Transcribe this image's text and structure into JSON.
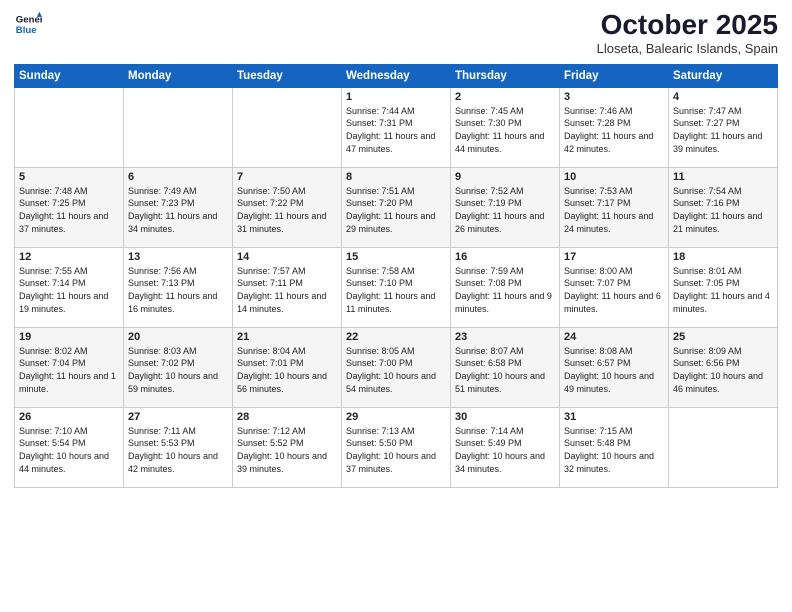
{
  "logo": {
    "line1": "General",
    "line2": "Blue"
  },
  "title": "October 2025",
  "subtitle": "Lloseta, Balearic Islands, Spain",
  "days_of_week": [
    "Sunday",
    "Monday",
    "Tuesday",
    "Wednesday",
    "Thursday",
    "Friday",
    "Saturday"
  ],
  "weeks": [
    [
      {
        "num": "",
        "info": ""
      },
      {
        "num": "",
        "info": ""
      },
      {
        "num": "",
        "info": ""
      },
      {
        "num": "1",
        "info": "Sunrise: 7:44 AM\nSunset: 7:31 PM\nDaylight: 11 hours and 47 minutes."
      },
      {
        "num": "2",
        "info": "Sunrise: 7:45 AM\nSunset: 7:30 PM\nDaylight: 11 hours and 44 minutes."
      },
      {
        "num": "3",
        "info": "Sunrise: 7:46 AM\nSunset: 7:28 PM\nDaylight: 11 hours and 42 minutes."
      },
      {
        "num": "4",
        "info": "Sunrise: 7:47 AM\nSunset: 7:27 PM\nDaylight: 11 hours and 39 minutes."
      }
    ],
    [
      {
        "num": "5",
        "info": "Sunrise: 7:48 AM\nSunset: 7:25 PM\nDaylight: 11 hours and 37 minutes."
      },
      {
        "num": "6",
        "info": "Sunrise: 7:49 AM\nSunset: 7:23 PM\nDaylight: 11 hours and 34 minutes."
      },
      {
        "num": "7",
        "info": "Sunrise: 7:50 AM\nSunset: 7:22 PM\nDaylight: 11 hours and 31 minutes."
      },
      {
        "num": "8",
        "info": "Sunrise: 7:51 AM\nSunset: 7:20 PM\nDaylight: 11 hours and 29 minutes."
      },
      {
        "num": "9",
        "info": "Sunrise: 7:52 AM\nSunset: 7:19 PM\nDaylight: 11 hours and 26 minutes."
      },
      {
        "num": "10",
        "info": "Sunrise: 7:53 AM\nSunset: 7:17 PM\nDaylight: 11 hours and 24 minutes."
      },
      {
        "num": "11",
        "info": "Sunrise: 7:54 AM\nSunset: 7:16 PM\nDaylight: 11 hours and 21 minutes."
      }
    ],
    [
      {
        "num": "12",
        "info": "Sunrise: 7:55 AM\nSunset: 7:14 PM\nDaylight: 11 hours and 19 minutes."
      },
      {
        "num": "13",
        "info": "Sunrise: 7:56 AM\nSunset: 7:13 PM\nDaylight: 11 hours and 16 minutes."
      },
      {
        "num": "14",
        "info": "Sunrise: 7:57 AM\nSunset: 7:11 PM\nDaylight: 11 hours and 14 minutes."
      },
      {
        "num": "15",
        "info": "Sunrise: 7:58 AM\nSunset: 7:10 PM\nDaylight: 11 hours and 11 minutes."
      },
      {
        "num": "16",
        "info": "Sunrise: 7:59 AM\nSunset: 7:08 PM\nDaylight: 11 hours and 9 minutes."
      },
      {
        "num": "17",
        "info": "Sunrise: 8:00 AM\nSunset: 7:07 PM\nDaylight: 11 hours and 6 minutes."
      },
      {
        "num": "18",
        "info": "Sunrise: 8:01 AM\nSunset: 7:05 PM\nDaylight: 11 hours and 4 minutes."
      }
    ],
    [
      {
        "num": "19",
        "info": "Sunrise: 8:02 AM\nSunset: 7:04 PM\nDaylight: 11 hours and 1 minute."
      },
      {
        "num": "20",
        "info": "Sunrise: 8:03 AM\nSunset: 7:02 PM\nDaylight: 10 hours and 59 minutes."
      },
      {
        "num": "21",
        "info": "Sunrise: 8:04 AM\nSunset: 7:01 PM\nDaylight: 10 hours and 56 minutes."
      },
      {
        "num": "22",
        "info": "Sunrise: 8:05 AM\nSunset: 7:00 PM\nDaylight: 10 hours and 54 minutes."
      },
      {
        "num": "23",
        "info": "Sunrise: 8:07 AM\nSunset: 6:58 PM\nDaylight: 10 hours and 51 minutes."
      },
      {
        "num": "24",
        "info": "Sunrise: 8:08 AM\nSunset: 6:57 PM\nDaylight: 10 hours and 49 minutes."
      },
      {
        "num": "25",
        "info": "Sunrise: 8:09 AM\nSunset: 6:56 PM\nDaylight: 10 hours and 46 minutes."
      }
    ],
    [
      {
        "num": "26",
        "info": "Sunrise: 7:10 AM\nSunset: 5:54 PM\nDaylight: 10 hours and 44 minutes."
      },
      {
        "num": "27",
        "info": "Sunrise: 7:11 AM\nSunset: 5:53 PM\nDaylight: 10 hours and 42 minutes."
      },
      {
        "num": "28",
        "info": "Sunrise: 7:12 AM\nSunset: 5:52 PM\nDaylight: 10 hours and 39 minutes."
      },
      {
        "num": "29",
        "info": "Sunrise: 7:13 AM\nSunset: 5:50 PM\nDaylight: 10 hours and 37 minutes."
      },
      {
        "num": "30",
        "info": "Sunrise: 7:14 AM\nSunset: 5:49 PM\nDaylight: 10 hours and 34 minutes."
      },
      {
        "num": "31",
        "info": "Sunrise: 7:15 AM\nSunset: 5:48 PM\nDaylight: 10 hours and 32 minutes."
      },
      {
        "num": "",
        "info": ""
      }
    ]
  ]
}
